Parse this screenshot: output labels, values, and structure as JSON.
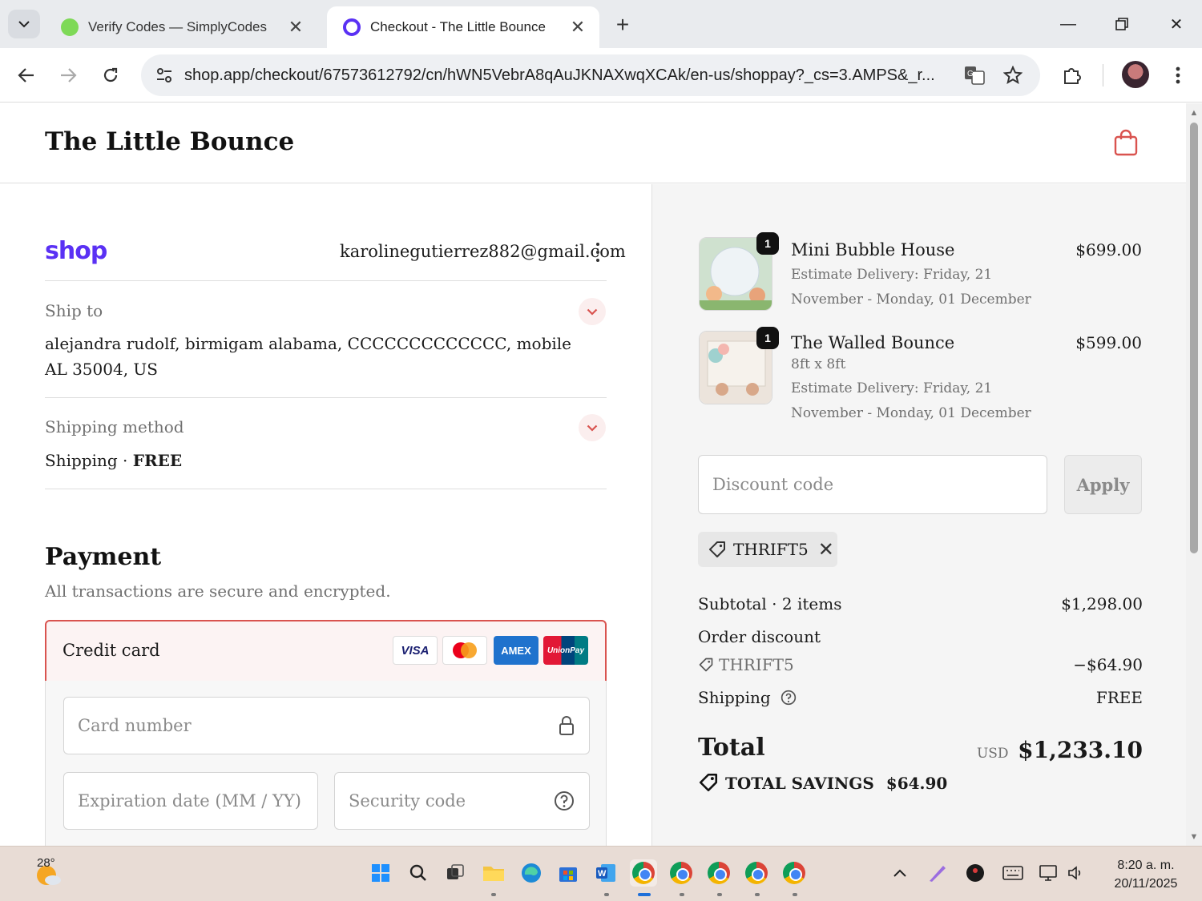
{
  "browser": {
    "tabs": [
      {
        "title": "Verify Codes — SimplyCodes",
        "active": false
      },
      {
        "title": "Checkout - The Little Bounce",
        "active": true
      }
    ],
    "url": "shop.app/checkout/67573612792/cn/hWN5VebrA8qAuJKNAXwqXCAk/en-us/shoppay?_cs=3.AMPS&_r..."
  },
  "store": {
    "name": "The Little Bounce"
  },
  "checkout": {
    "shop_logo": "shop",
    "account_email": "karolinegutierrez882@gmail.com",
    "ship_to": {
      "label": "Ship to",
      "address": "alejandra rudolf, birmigam alabama, CCCCCCCCCCCCC, mobile AL 35004, US"
    },
    "shipping_method": {
      "label": "Shipping method",
      "name": "Shipping",
      "separator": "·",
      "price": "FREE"
    },
    "payment": {
      "title": "Payment",
      "subtitle": "All transactions are secure and encrypted.",
      "method_label": "Credit card",
      "card_brands": [
        "VISA",
        "Mastercard",
        "AMEX",
        "UnionPay"
      ],
      "fields": {
        "card_number": "Card number",
        "expiration": "Expiration date (MM / YY)",
        "security_code": "Security code"
      }
    }
  },
  "summary": {
    "items": [
      {
        "name": "Mini Bubble House",
        "qty": "1",
        "details": [
          "Estimate Delivery: Friday, 21 November - Monday, 01 December"
        ],
        "price": "$699.00"
      },
      {
        "name": "The Walled Bounce",
        "qty": "1",
        "details": [
          "8ft x 8ft",
          "Estimate Delivery: Friday, 21 November - Monday, 01 December"
        ],
        "price": "$599.00"
      }
    ],
    "discount_placeholder": "Discount code",
    "apply_label": "Apply",
    "applied_code": "THRIFT5",
    "subtotal_label": "Subtotal · 2 items",
    "subtotal": "$1,298.00",
    "order_discount_label": "Order discount",
    "discount_code": "THRIFT5",
    "discount_amount": "−$64.90",
    "shipping_label": "Shipping",
    "shipping_value": "FREE",
    "total_label": "Total",
    "currency": "USD",
    "total": "$1,233.10",
    "savings_label": "TOTAL SAVINGS",
    "savings": "$64.90"
  },
  "taskbar": {
    "weather_temp": "28°",
    "time": "8:20 a. m.",
    "date": "20/11/2025"
  },
  "colors": {
    "accent_red": "#d9534f",
    "shop_purple": "#5a31f4",
    "summary_bg": "#f5f5f5"
  }
}
